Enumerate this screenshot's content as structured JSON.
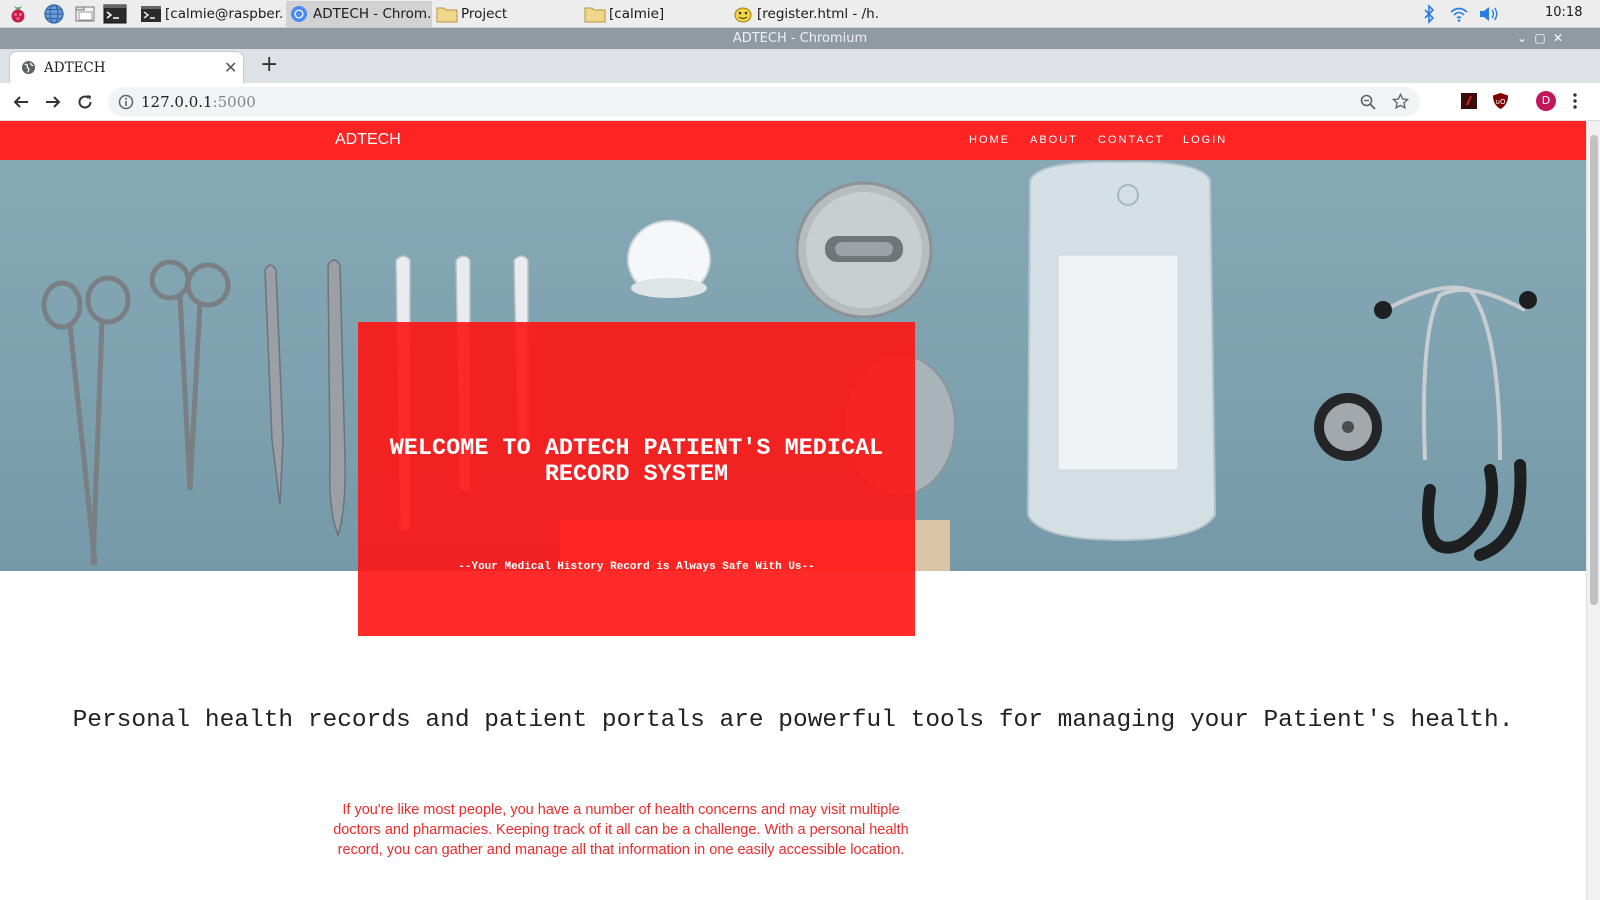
{
  "taskbar": {
    "launchers": [
      "raspberry-menu-icon",
      "web-browser-icon",
      "file-manager-icon",
      "terminal-icon"
    ],
    "windows": [
      {
        "label": "[calmie@raspber...",
        "icon": "terminal-icon"
      },
      {
        "label": "ADTECH - Chrom...",
        "icon": "chromium-icon"
      },
      {
        "label": "Project",
        "icon": "folder-icon"
      },
      {
        "label": "[calmie]",
        "icon": "folder-icon"
      },
      {
        "label": "[register.html - /h...",
        "icon": "text-editor-icon"
      }
    ],
    "tray": [
      "bluetooth-icon",
      "wifi-icon",
      "volume-icon"
    ],
    "clock": "10:18"
  },
  "window": {
    "title": "ADTECH - Chromium"
  },
  "browser": {
    "tab_title": "ADTECH",
    "url_host": "127.0.0.1",
    "url_port": ":5000",
    "profile_initial": "D"
  },
  "site": {
    "brand": "ADTECH",
    "nav": [
      "HOME",
      "ABOUT",
      "CONTACT",
      "LOGIN"
    ],
    "hero": {
      "title": "WELCOME TO ADTECH PATIENT'S MEDICAL RECORD SYSTEM",
      "subtitle": "--Your Medical History Record is Always Safe With Us--"
    },
    "headline": "Personal health records and patient portals are powerful tools for managing your Patient's health.",
    "intro": "If you're like most people, you have a number of health concerns and may visit multiple doctors and pharmacies. Keeping track of it all can be a challenge. With a personal health record, you can gather and manage all that information in one easily accessible location."
  },
  "colors": {
    "brand_red": "#fe2424",
    "taskbar": "#ededed",
    "titlebar": "#8f9aa3"
  }
}
